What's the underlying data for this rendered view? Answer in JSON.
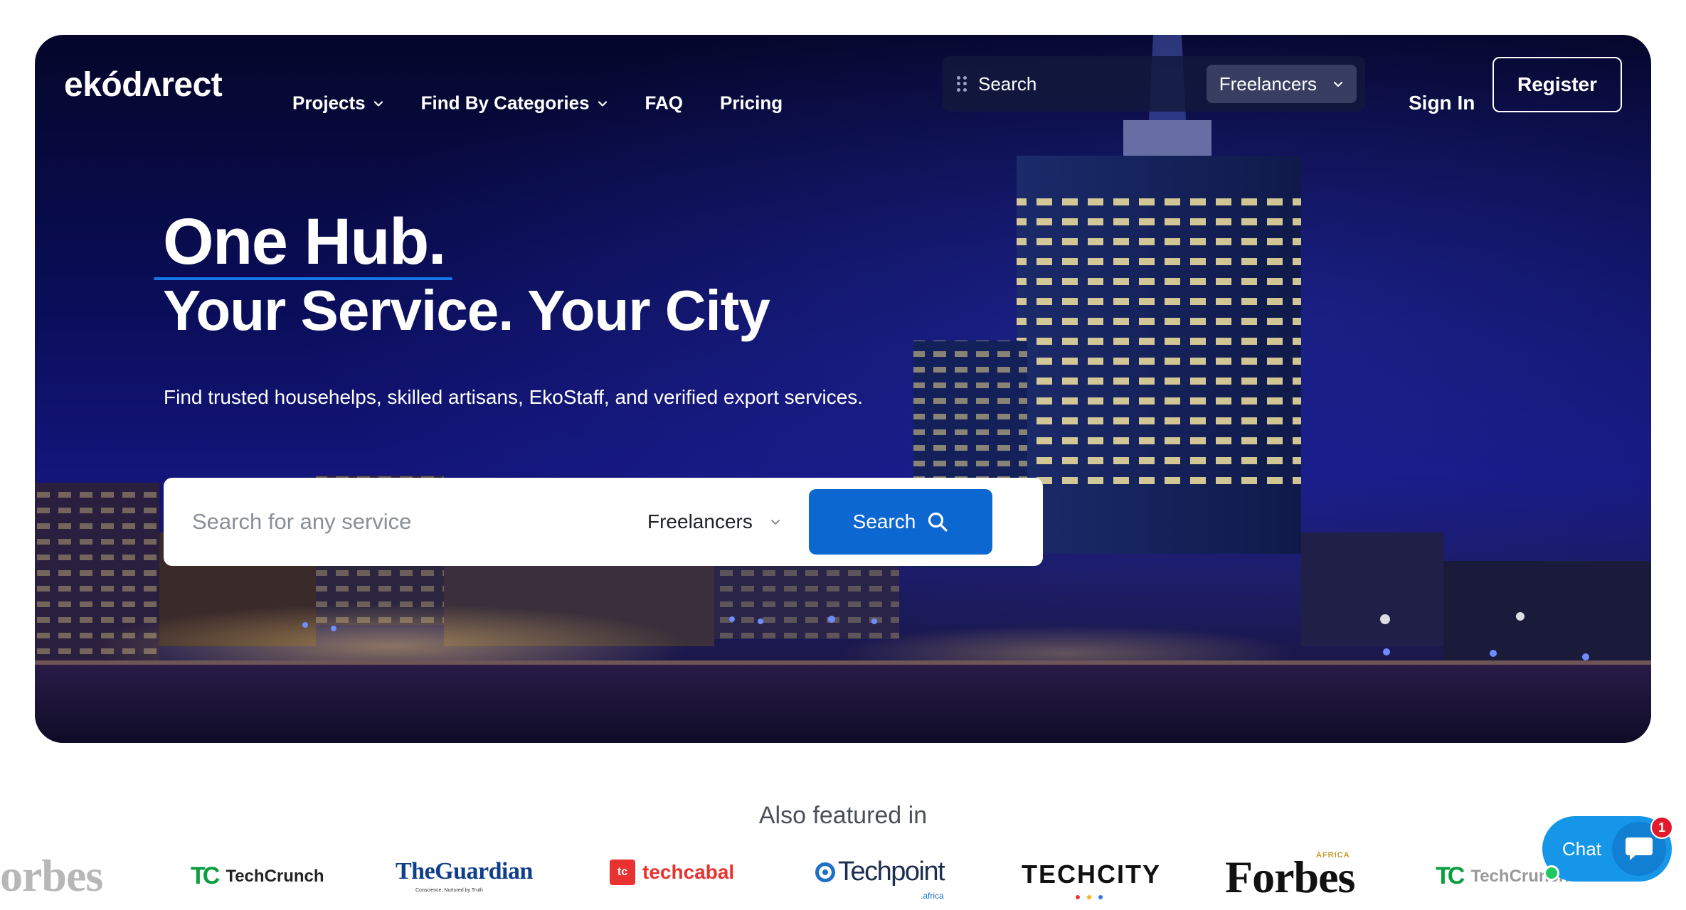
{
  "colors": {
    "accent_blue": "#0d67d1",
    "underline_blue": "#1677e8",
    "chat_blue": "#1596e8",
    "badge_red": "#e21b2c",
    "online_green": "#1fc760"
  },
  "header": {
    "logo": "ekódʌrect",
    "nav": [
      {
        "label": "Projects",
        "icon": "chevron-down-icon"
      },
      {
        "label": "Find By Categories",
        "icon": "chevron-down-icon"
      },
      {
        "label": "FAQ"
      },
      {
        "label": "Pricing"
      }
    ],
    "search": {
      "placeholder": "Search",
      "select_value": "Freelancers"
    },
    "sign_in": "Sign In",
    "register": "Register"
  },
  "hero": {
    "title_line1": "One Hub.",
    "title_line2": "Your Service. Your City",
    "subtitle": "Find trusted househelps, skilled artisans, EkoStaff, and verified export services.",
    "search": {
      "placeholder": "Search for any service",
      "select_value": "Freelancers",
      "button": "Search"
    }
  },
  "featured": {
    "title": "Also featured in",
    "logos": [
      "orbes",
      "TechCrunch",
      "TheGuardian",
      "techcabal",
      "Techpoint",
      "TECHCITY",
      "Forbes",
      "TechCrunch"
    ],
    "forbes_tag": "AFRICA",
    "guardian_tagline": "Conscience, Nurtured by Truth",
    "techpoint_tag": ".africa",
    "techcabal_mark": "tc"
  },
  "chat": {
    "label": "Chat",
    "badge": "1"
  }
}
